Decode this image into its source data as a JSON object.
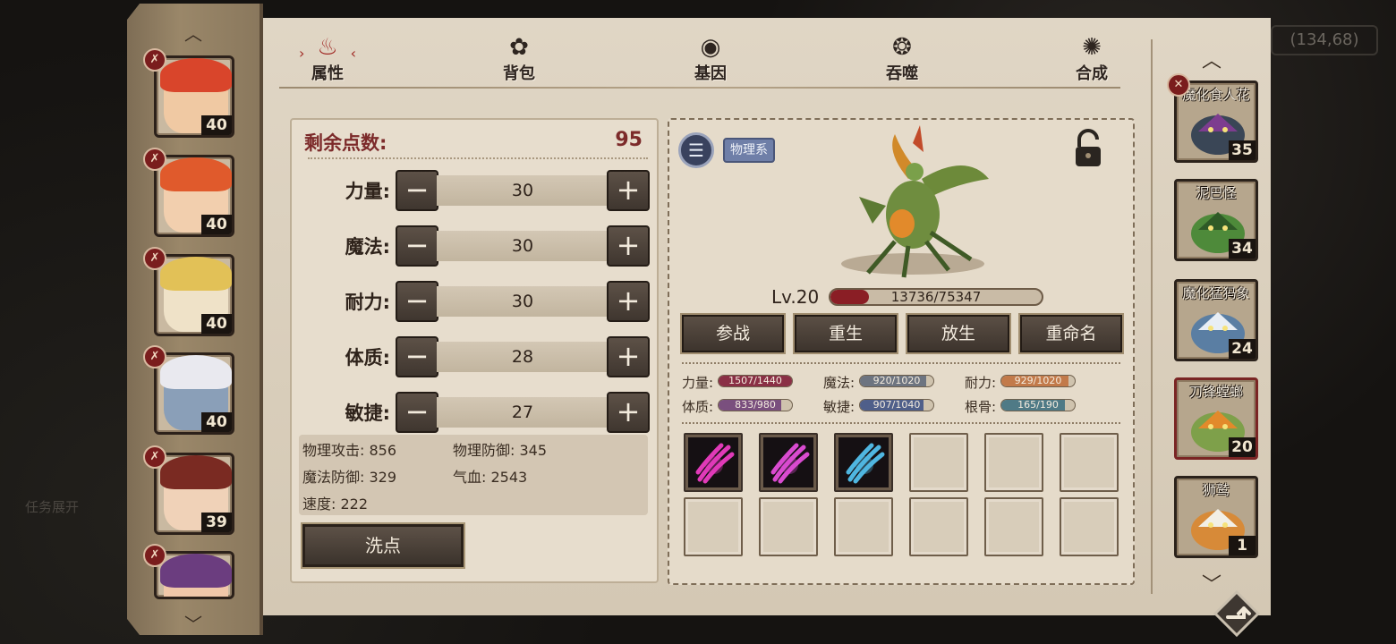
{
  "background": {
    "coord_text": "(134,68)",
    "task_text": "任务展开"
  },
  "tabs": [
    {
      "label": "属性",
      "icon": "flame-icon",
      "active": true
    },
    {
      "label": "背包",
      "icon": "bag-icon",
      "active": false
    },
    {
      "label": "基因",
      "icon": "gene-icon",
      "active": false
    },
    {
      "label": "吞噬",
      "icon": "devour-icon",
      "active": false
    },
    {
      "label": "合成",
      "icon": "synthesis-icon",
      "active": false
    }
  ],
  "left_portraits": [
    {
      "level": "40",
      "hair": "#d9452b",
      "skin": "#f0c9a3",
      "badge": "✗"
    },
    {
      "level": "40",
      "hair": "#e05a2c",
      "skin": "#f2cfae",
      "badge": "✗"
    },
    {
      "level": "40",
      "hair": "#e2c157",
      "skin": "#efe2c8",
      "badge": "✗"
    },
    {
      "level": "40",
      "hair": "#e9e9ef",
      "skin": "#8a9fb8",
      "badge": "✗"
    },
    {
      "level": "39",
      "hair": "#7a2a22",
      "skin": "#f0d2b8",
      "badge": "✗"
    },
    {
      "level": "",
      "hair": "#6b3d7f",
      "skin": "#f0c7a9",
      "badge": "✗"
    }
  ],
  "points": {
    "label": "剩余点数:",
    "value": "95"
  },
  "stats": [
    {
      "label": "力量:",
      "value": "30",
      "minus": "−",
      "plus": "+"
    },
    {
      "label": "魔法:",
      "value": "30",
      "minus": "−",
      "plus": "+"
    },
    {
      "label": "耐力:",
      "value": "30",
      "minus": "−",
      "plus": "+"
    },
    {
      "label": "体质:",
      "value": "28",
      "minus": "−",
      "plus": "+"
    },
    {
      "label": "敏捷:",
      "value": "27",
      "minus": "−",
      "plus": "+"
    }
  ],
  "derived": {
    "phys_atk": "物理攻击: 856",
    "phys_def": "物理防御: 345",
    "mag_def": "魔法防御: 329",
    "hp": "气血: 2543",
    "speed": "速度: 222"
  },
  "wash_button": "洗点",
  "pet": {
    "type_tag": "物理系",
    "menu_icon": "☰",
    "level_text": "Lv.20",
    "exp_text": "13736/75347",
    "exp_fraction": 0.182,
    "actions": [
      "参战",
      "重生",
      "放生",
      "重命名"
    ],
    "aptitudes": [
      {
        "label": "力量:",
        "text": "1507/1440",
        "fraction": 1.0,
        "color": "#8a2f45"
      },
      {
        "label": "魔法:",
        "text": "920/1020",
        "fraction": 0.9,
        "color": "#6d7480"
      },
      {
        "label": "耐力:",
        "text": "929/1020",
        "fraction": 0.91,
        "color": "#c27a4a"
      },
      {
        "label": "体质:",
        "text": "833/980",
        "fraction": 0.85,
        "color": "#7a4f7e"
      },
      {
        "label": "敏捷:",
        "text": "907/1040",
        "fraction": 0.87,
        "color": "#4f5f8a"
      },
      {
        "label": "根骨:",
        "text": "165/190",
        "fraction": 0.87,
        "color": "#4f7a86"
      }
    ],
    "skills": [
      {
        "filled": true,
        "color": "#e03ab8",
        "name": "claw-skill-icon"
      },
      {
        "filled": true,
        "color": "#d94bd0",
        "name": "spike-skill-icon"
      },
      {
        "filled": true,
        "color": "#4fb6e0",
        "name": "frost-claw-skill-icon"
      },
      {
        "filled": false
      },
      {
        "filled": false
      },
      {
        "filled": false
      },
      {
        "filled": false
      },
      {
        "filled": false
      },
      {
        "filled": false
      },
      {
        "filled": false
      },
      {
        "filled": false
      },
      {
        "filled": false
      }
    ]
  },
  "pet_list": [
    {
      "name": "魔化食人花",
      "level": "35",
      "body": "#3a4656",
      "accent": "#7d3d8f",
      "active": false
    },
    {
      "name": "泥巴怪",
      "level": "34",
      "body": "#4e8a3a",
      "accent": "#2f5a27",
      "active": false
    },
    {
      "name": "魔化猛犸象",
      "level": "24",
      "body": "#5a7ea3",
      "accent": "#e8eef5",
      "active": false
    },
    {
      "name": "刀锋螳螂",
      "level": "20",
      "body": "#7ea04a",
      "accent": "#e28a2b",
      "active": true
    },
    {
      "name": "狮鹫",
      "level": "1",
      "body": "#d78a38",
      "accent": "#f2efe6",
      "active": false
    }
  ]
}
